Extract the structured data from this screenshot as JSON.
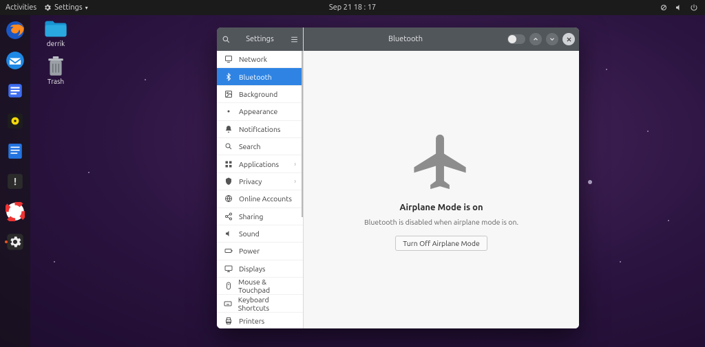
{
  "topbar": {
    "activities": "Activities",
    "app_name": "Settings",
    "datetime": "Sep 21  18 : 17"
  },
  "desktop": {
    "folder_label": "derrik",
    "trash_label": "Trash"
  },
  "sidebar": {
    "title": "Settings",
    "items": [
      {
        "icon": "network",
        "label": "Network",
        "has_sub": false
      },
      {
        "icon": "bluetooth",
        "label": "Bluetooth",
        "has_sub": false,
        "selected": true
      },
      {
        "icon": "background",
        "label": "Background",
        "has_sub": false
      },
      {
        "icon": "appearance",
        "label": "Appearance",
        "has_sub": false
      },
      {
        "icon": "notifications",
        "label": "Notifications",
        "has_sub": false
      },
      {
        "icon": "search",
        "label": "Search",
        "has_sub": false
      },
      {
        "icon": "applications",
        "label": "Applications",
        "has_sub": true
      },
      {
        "icon": "privacy",
        "label": "Privacy",
        "has_sub": true
      },
      {
        "icon": "accounts",
        "label": "Online Accounts",
        "has_sub": false
      },
      {
        "icon": "sharing",
        "label": "Sharing",
        "has_sub": false
      },
      {
        "icon": "sound",
        "label": "Sound",
        "has_sub": false
      },
      {
        "icon": "power",
        "label": "Power",
        "has_sub": false
      },
      {
        "icon": "displays",
        "label": "Displays",
        "has_sub": false
      },
      {
        "icon": "mouse",
        "label": "Mouse & Touchpad",
        "has_sub": false
      },
      {
        "icon": "keyboard",
        "label": "Keyboard Shortcuts",
        "has_sub": false
      },
      {
        "icon": "printers",
        "label": "Printers",
        "has_sub": false
      }
    ]
  },
  "panel": {
    "title": "Bluetooth",
    "heading": "Airplane Mode is on",
    "subtext": "Bluetooth is disabled when airplane mode is on.",
    "button": "Turn Off Airplane Mode"
  }
}
